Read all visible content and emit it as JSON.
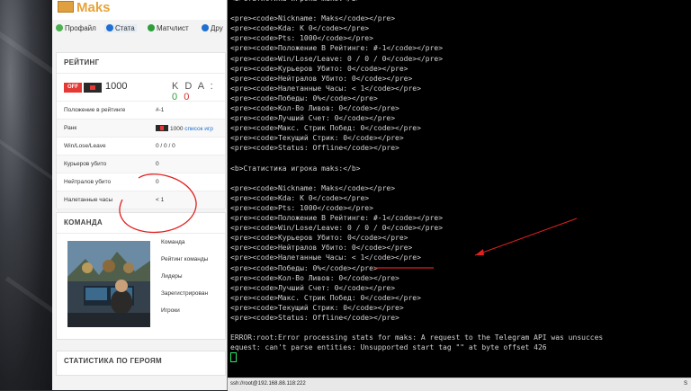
{
  "web": {
    "brand": "Maks",
    "tabs": [
      "Профайл",
      "Стата",
      "Матчлист",
      "Дру"
    ],
    "rating": {
      "header": "РЕЙТИНГ",
      "off_label": "OFF",
      "elo": "1000",
      "kda_label": "K D A :",
      "kda_k": "0",
      "kda_d": "0",
      "stats": [
        {
          "label": "Положение в рейтинге",
          "value": "#-1"
        },
        {
          "label": "Ранк",
          "value": "1000",
          "link": "список игр"
        },
        {
          "label": "Win/Lose/Leave",
          "value": "0 / 0 / 0"
        },
        {
          "label": "Курьеров убито",
          "value": "0"
        },
        {
          "label": "Нейтралов убито",
          "value": "0"
        },
        {
          "label": "Налетанные часы",
          "value": "< 1"
        }
      ]
    },
    "team": {
      "header": "КОМАНДА",
      "labels": [
        "Команда",
        "Рейтинг команды",
        "Лидеры",
        "Зарегистрирован",
        "Игроки"
      ]
    },
    "heroes": {
      "header": "СТАТИСТИКА ПО ГЕРОЯМ"
    }
  },
  "terminal": {
    "lines": [
      "<b>Статистика игрока maks:</b>",
      "",
      "<pre><code>Nickname: Maks</code></pre>",
      "<pre><code>Kda: K 0</code></pre>",
      "<pre><code>Pts: 1000</code></pre>",
      "<pre><code>Положение В Рейтинге: #-1</code></pre>",
      "<pre><code>Win/Lose/Leave: 0 / 0 / 0</code></pre>",
      "<pre><code>Курьеров Убито: 0</code></pre>",
      "<pre><code>Нейтралов Убито: 0</code></pre>",
      "<pre><code>Налетанные Часы: < 1</code></pre>",
      "<pre><code>Победы: 0%</code></pre>",
      "<pre><code>Кол-Во Ливов: 0</code></pre>",
      "<pre><code>Лучший Счет: 0</code></pre>",
      "<pre><code>Макс. Стрик Побед: 0</code></pre>",
      "<pre><code>Текущий Стрик: 0</code></pre>",
      "<pre><code>Status: Offline</code></pre>",
      "",
      "<b>Статистика игрока maks:</b>",
      "",
      "<pre><code>Nickname: Maks</code></pre>",
      "<pre><code>Kda: K 0</code></pre>",
      "<pre><code>Pts: 1000</code></pre>",
      "<pre><code>Положение В Рейтинге: #-1</code></pre>",
      "<pre><code>Win/Lose/Leave: 0 / 0 / 0</code></pre>",
      "<pre><code>Курьеров Убито: 0</code></pre>",
      "<pre><code>Нейтралов Убито: 0</code></pre>",
      "<pre><code>Налетанные Часы: < 1</code></pre>",
      "<pre><code>Победы: 0%</code></pre>",
      "<pre><code>Кол-Во Ливов: 0</code></pre>",
      "<pre><code>Лучший Счет: 0</code></pre>",
      "<pre><code>Макс. Стрик Побед: 0</code></pre>",
      "<pre><code>Текущий Стрик: 0</code></pre>",
      "<pre><code>Status: Offline</code></pre>",
      "",
      "ERROR:root:Error processing stats for maks: A request to the Telegram API was unsucces",
      "equest: can't parse entities: Unsupported start tag \"\" at byte offset 426"
    ]
  },
  "statusbar": {
    "left": "ssh://root@192.168.88.118:222",
    "right": "S"
  },
  "colors": {
    "annotation": "#e02020",
    "cursor": "#2ee86a",
    "brand": "#e8a33a"
  }
}
